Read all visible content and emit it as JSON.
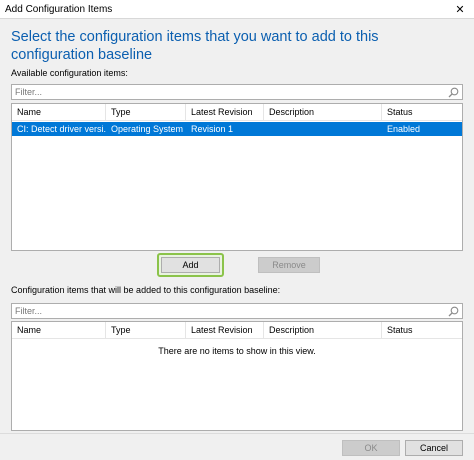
{
  "window": {
    "title": "Add Configuration Items",
    "close_glyph": "✕"
  },
  "heading": "Select the configuration items that you want to add to this configuration baseline",
  "available": {
    "label": "Available configuration items:",
    "filter_placeholder": "Filter...",
    "columns": [
      "Name",
      "Type",
      "Latest Revision",
      "Description",
      "Status"
    ],
    "rows": [
      {
        "name": "CI: Detect driver versi...",
        "type": "Operating System",
        "latest_revision": "Revision 1",
        "description": "",
        "status": "Enabled",
        "selected": true
      }
    ]
  },
  "buttons": {
    "add": "Add",
    "remove": "Remove",
    "ok": "OK",
    "cancel": "Cancel"
  },
  "target": {
    "label": "Configuration items that will be added to this configuration baseline:",
    "filter_placeholder": "Filter...",
    "columns": [
      "Name",
      "Type",
      "Latest Revision",
      "Description",
      "Status"
    ],
    "empty_message": "There are no items to show in this view."
  },
  "colors": {
    "heading": "#0b5fb0",
    "selection": "#0078d7",
    "add_highlight": "#8bc34a"
  }
}
